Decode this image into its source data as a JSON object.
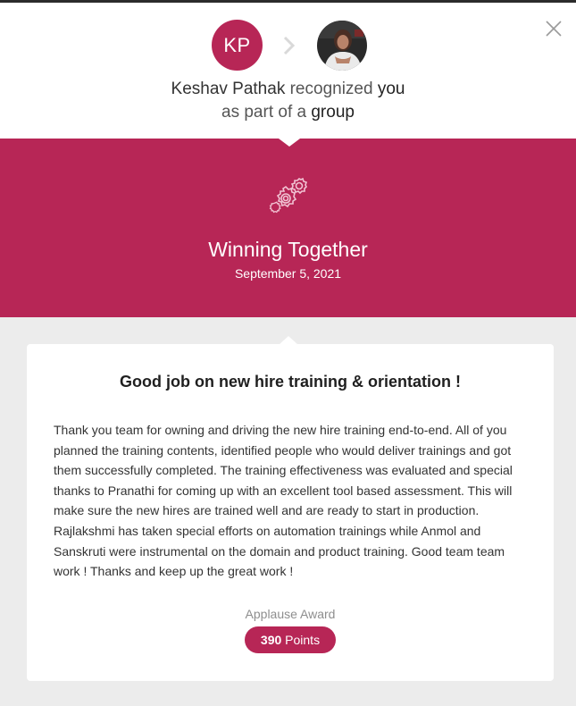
{
  "header": {
    "sender_initials": "KP",
    "sender_name": "Keshav Pathak",
    "verb": "recognized",
    "recipient": "you",
    "line2_prefix": "as part of a",
    "line2_emphasis": "group"
  },
  "award": {
    "title": "Winning Together",
    "date": "September 5, 2021",
    "icon": "gears-icon"
  },
  "message": {
    "title": "Good job on new hire training & orientation !",
    "body": "Thank you team for owning and driving the new hire training end-to-end. All of you planned the training contents, identified people who would deliver trainings and got them successfully completed. The training effectiveness was evaluated and special thanks to Pranathi for coming up with an excellent tool based assessment. This will make sure the new hires are trained well and are ready to start in production. Rajlakshmi has taken special efforts on automation trainings while Anmol and Sanskruti were instrumental on the domain and product training. Good team team work ! Thanks and keep up the great work !"
  },
  "reward": {
    "type": "Applause Award",
    "points_value": "390",
    "points_label": "Points"
  },
  "colors": {
    "accent": "#b72656",
    "background": "#ececec"
  }
}
